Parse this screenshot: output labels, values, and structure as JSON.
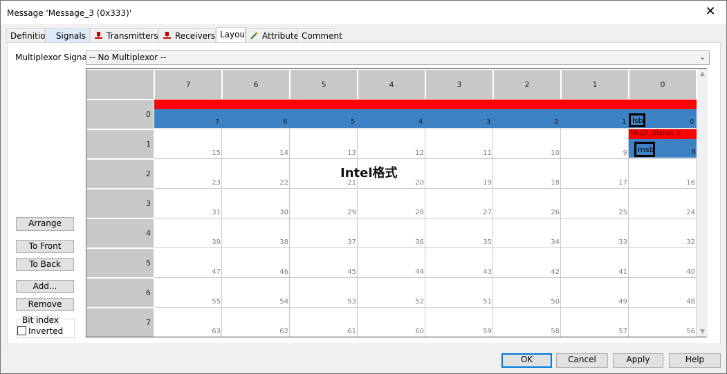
{
  "window": {
    "title": "Message 'Message_3 (0x333)'",
    "close_label": "✕"
  },
  "tabs": [
    {
      "label": "Definition",
      "icon": ""
    },
    {
      "label": "Signals",
      "icon": ""
    },
    {
      "label": "Transmitters",
      "icon": "transmitter-icon"
    },
    {
      "label": "Receivers",
      "icon": "receiver-icon"
    },
    {
      "label": "Layout",
      "icon": ""
    },
    {
      "label": "Attributes",
      "icon": "attributes-icon"
    },
    {
      "label": "Comment",
      "icon": ""
    }
  ],
  "active_tab": "Layout",
  "multiplexor": {
    "label": "Multiplexor Signal:",
    "value": "-- No Multiplexor --"
  },
  "layout_grid": {
    "column_headers": [
      "7",
      "6",
      "5",
      "4",
      "3",
      "2",
      "1",
      "0"
    ],
    "row_headers": [
      "0",
      "1",
      "2",
      "3",
      "4",
      "5",
      "6",
      "7"
    ],
    "bit_numbers": [
      [
        "7",
        "6",
        "5",
        "4",
        "3",
        "2",
        "1",
        "0"
      ],
      [
        "15",
        "14",
        "13",
        "12",
        "11",
        "10",
        "9",
        "8"
      ],
      [
        "23",
        "22",
        "21",
        "20",
        "19",
        "18",
        "17",
        "16"
      ],
      [
        "31",
        "30",
        "29",
        "28",
        "27",
        "26",
        "25",
        "24"
      ],
      [
        "39",
        "38",
        "37",
        "36",
        "35",
        "34",
        "33",
        "32"
      ],
      [
        "47",
        "46",
        "45",
        "44",
        "43",
        "42",
        "41",
        "40"
      ],
      [
        "55",
        "54",
        "53",
        "52",
        "51",
        "50",
        "49",
        "48"
      ],
      [
        "63",
        "62",
        "61",
        "60",
        "59",
        "58",
        "57",
        "56"
      ]
    ],
    "signal_name": "Msg3_Signal_1",
    "lsb_label": "lsb",
    "msb_label": "msb",
    "annotation": "Intel格式",
    "signal_color": "#3e82c6",
    "header_bar_color": "#ff0000"
  },
  "left_buttons": {
    "arrange": "Arrange",
    "to_front": "To Front",
    "to_back": "To Back",
    "add": "Add...",
    "remove": "Remove"
  },
  "bit_index": {
    "group_label": "Bit index",
    "inverted_label": "Inverted",
    "inverted_checked": false
  },
  "footer": {
    "ok": "OK",
    "cancel": "Cancel",
    "apply": "Apply",
    "help": "Help"
  }
}
